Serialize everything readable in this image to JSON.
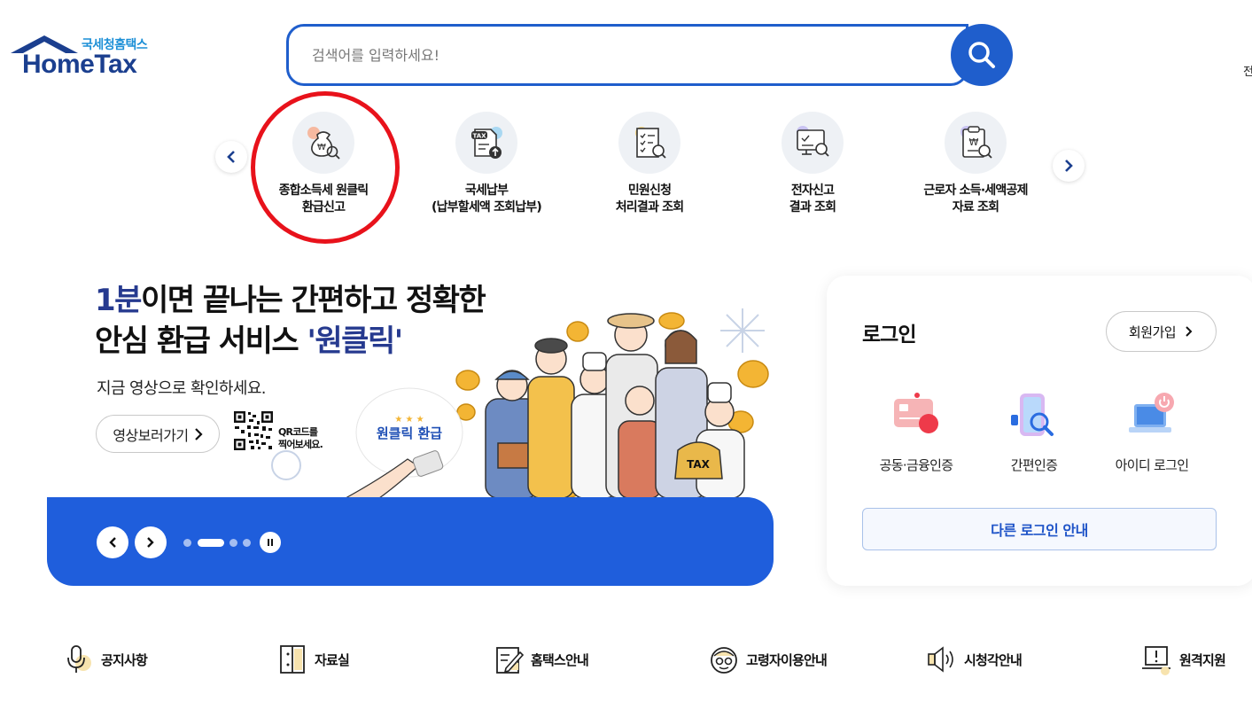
{
  "header": {
    "logo_sub": "국세청홈택스",
    "logo_main": "HomeTax",
    "search_placeholder": "검색어를 입력하세요!",
    "edge_text": "전"
  },
  "quick_menu": {
    "items": [
      {
        "line1": "종합소득세 원클릭",
        "line2": "환급신고",
        "icon": "money-bag-search-icon",
        "highlighted": true
      },
      {
        "line1": "국세납부",
        "line2": "(납부할세액 조회납부)",
        "icon": "tax-document-upload-icon"
      },
      {
        "line1": "민원신청",
        "line2": "처리결과 조회",
        "icon": "checklist-search-icon"
      },
      {
        "line1": "전자신고",
        "line2": "결과 조회",
        "icon": "monitor-search-icon"
      },
      {
        "line1": "근로자 소득·세액공제",
        "line2": "자료 조회",
        "icon": "clipboard-won-search-icon"
      }
    ]
  },
  "banner": {
    "headline_accent": "1분",
    "headline_rest": "이면 끝나는 간편하고 정확한",
    "headline_line2": "안심 환급 서비스 ",
    "headline_quote": "'원클릭'",
    "subtitle": "지금 영상으로 확인하세요.",
    "video_button": "영상보러가기",
    "qr_text_line1": "QR코드를",
    "qr_text_line2": "찍어보세요.",
    "bubble_text": "원클릭 환급",
    "bag_text": "TAX",
    "slides_total": 4,
    "active_slide": 2
  },
  "login": {
    "title": "로그인",
    "join_button": "회원가입",
    "options": [
      {
        "label": "공동·금융인증",
        "icon": "certificate-card-icon"
      },
      {
        "label": "간편인증",
        "icon": "phone-search-icon"
      },
      {
        "label": "아이디 로그인",
        "icon": "laptop-power-icon"
      }
    ],
    "other_login": "다른 로그인 안내"
  },
  "bottom_links": [
    {
      "label": "공지사항",
      "icon": "microphone-icon"
    },
    {
      "label": "자료실",
      "icon": "cabinet-icon"
    },
    {
      "label": "홈택스안내",
      "icon": "pencil-note-icon"
    },
    {
      "label": "고령자이용안내",
      "icon": "senior-face-icon"
    },
    {
      "label": "시청각안내",
      "icon": "speaker-icon"
    },
    {
      "label": "원격지원",
      "icon": "laptop-alert-icon"
    }
  ],
  "colors": {
    "brand_blue": "#1f5ecc",
    "banner_blue": "#1f5edc",
    "highlight_red": "#e8121b",
    "headline_accent": "#263a8f"
  }
}
